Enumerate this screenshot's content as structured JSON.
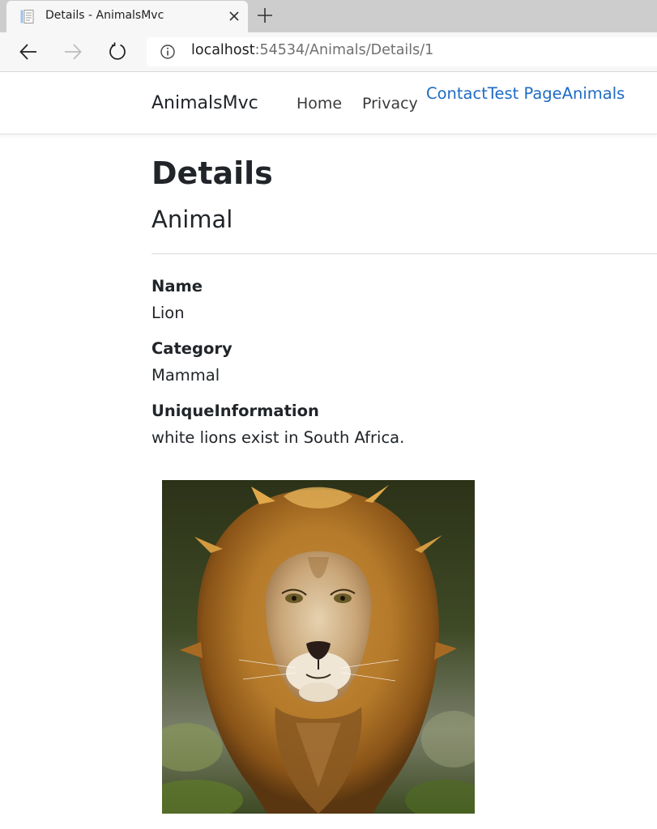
{
  "browser": {
    "tab_title": "Details - AnimalsMvc",
    "url_host": "localhost",
    "url_path": ":54534/Animals/Details/1"
  },
  "header": {
    "brand": "AnimalsMvc",
    "nav": {
      "home": "Home",
      "privacy": "Privacy",
      "contact": "Contact",
      "test_page": "Test Page",
      "animals": "Animals"
    }
  },
  "main": {
    "title": "Details",
    "subtitle": "Animal",
    "fields": [
      {
        "label": "Name",
        "value": "Lion"
      },
      {
        "label": "Category",
        "value": "Mammal"
      },
      {
        "label": "UniqueInformation",
        "value": "white lions exist in South Africa."
      }
    ]
  },
  "icons": {
    "tab_favicon": "document-icon",
    "tab_close": "close-icon",
    "new_tab": "plus-icon",
    "back": "arrow-left-icon",
    "forward": "arrow-right-icon",
    "refresh": "refresh-icon",
    "site_info": "info-icon"
  },
  "colors": {
    "link_blue": "#1f6bc4",
    "tab_strip": "#cdcdcd"
  }
}
